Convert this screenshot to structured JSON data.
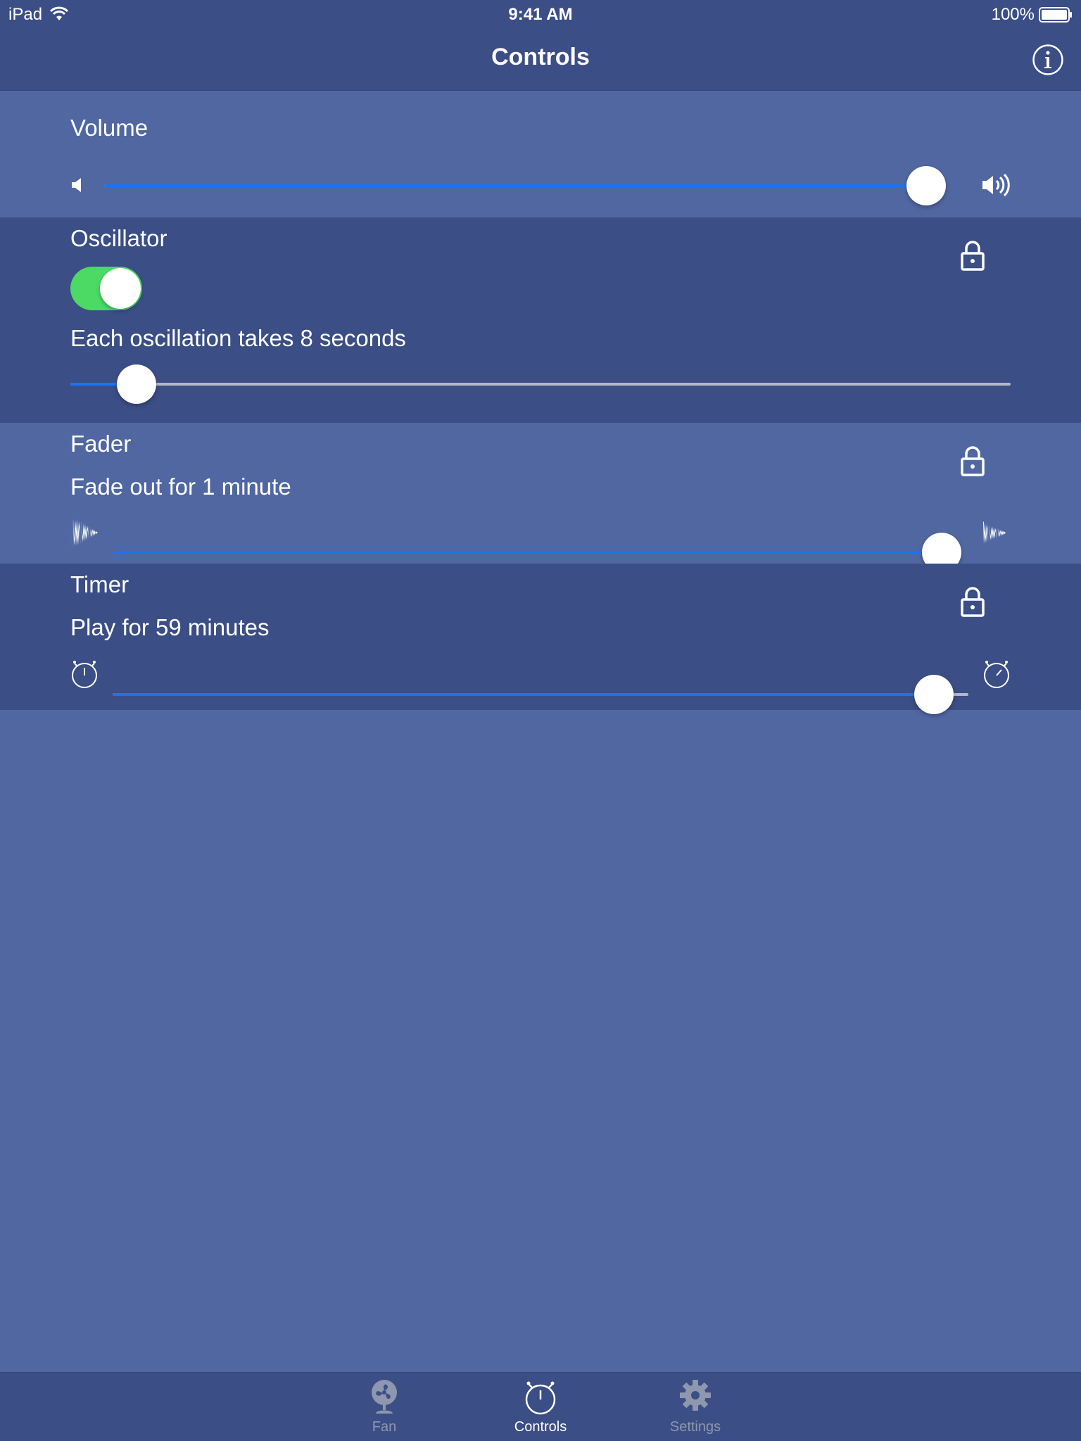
{
  "status_bar": {
    "device": "iPad",
    "time": "9:41 AM",
    "battery": "100%"
  },
  "nav": {
    "title": "Controls"
  },
  "volume": {
    "title": "Volume",
    "level": 0.98
  },
  "oscillator": {
    "title": "Oscillator",
    "enabled": true,
    "description": "Each oscillation takes 8 seconds",
    "level": 0.07
  },
  "fader": {
    "title": "Fader",
    "description": "Fade out for 1 minute",
    "level": 0.99
  },
  "timer": {
    "title": "Timer",
    "description": "Play for 59 minutes",
    "level": 0.96
  },
  "tabs": [
    {
      "label": "Fan",
      "icon": "fan-icon",
      "active": false
    },
    {
      "label": "Controls",
      "icon": "stopwatch-icon",
      "active": true
    },
    {
      "label": "Settings",
      "icon": "gear-icon",
      "active": false
    }
  ],
  "colors": {
    "accent": "#1a73f5",
    "toggle_on": "#4cd964",
    "background_light": "#5067a1",
    "background_dark": "#3b4e85"
  }
}
